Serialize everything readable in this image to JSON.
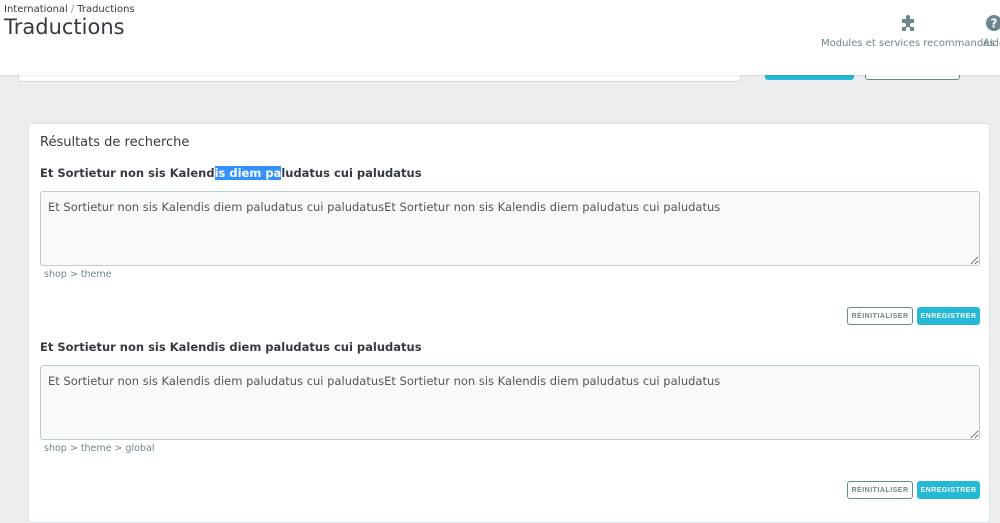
{
  "header": {
    "breadcrumb": [
      "International",
      "Traductions"
    ],
    "breadcrumb_sep": "/",
    "title": "Traductions",
    "tools": [
      {
        "label": "Modules et services recommandés",
        "icon": "puzzle-icon"
      },
      {
        "label": "Aide",
        "icon": "help-icon"
      }
    ]
  },
  "results": {
    "title": "Résultats de recherche",
    "items": [
      {
        "title_before": "Et Sortietur non sis Kalend",
        "title_selected": "is diem pa",
        "title_after": "ludatus cui paludatus",
        "value": "Et Sortietur non sis Kalendis diem paludatus cui paludatusEt Sortietur non sis Kalendis diem paludatus cui paludatus",
        "path": "shop > theme",
        "reset": "RÉINITIALISER",
        "save": "ENREGISTRER"
      },
      {
        "title": "Et Sortietur non sis Kalendis diem paludatus cui paludatus",
        "value": "Et Sortietur non sis Kalendis diem paludatus cui paludatusEt Sortietur non sis Kalendis diem paludatus cui paludatus",
        "path": "shop > theme > global",
        "reset": "RÉINITIALISER",
        "save": "ENREGISTRER"
      }
    ]
  },
  "colors": {
    "accent": "#25b9d7",
    "selection": "#3390ff"
  }
}
